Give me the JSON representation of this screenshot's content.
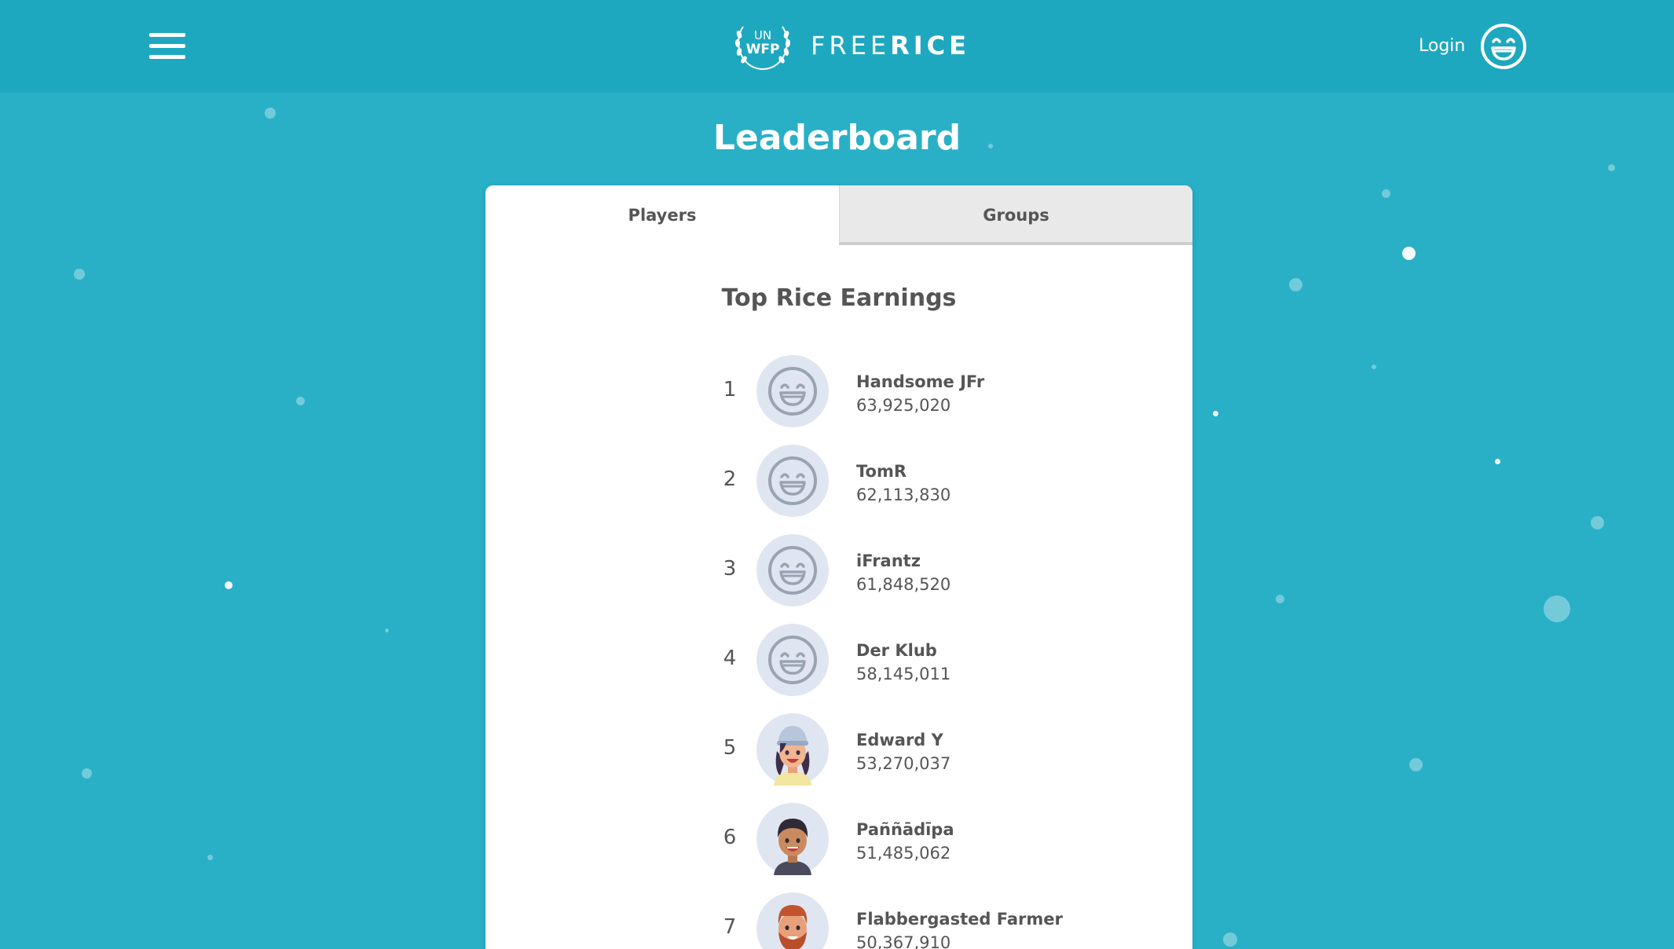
{
  "header": {
    "logo_un": "UN",
    "logo_wfp": "WFP",
    "logo_free": "FREE",
    "logo_rice": "RICE",
    "login_label": "Login",
    "brand_color": "#1ea8c0",
    "background_color": "#29b0c6"
  },
  "page": {
    "title": "Leaderboard"
  },
  "tabs": [
    {
      "label": "Players",
      "active": true
    },
    {
      "label": "Groups",
      "active": false
    }
  ],
  "leaderboard": {
    "title": "Top Rice Earnings",
    "entries": [
      {
        "rank": "1",
        "name": "Handsome JFr",
        "score": "63,925,020",
        "avatar": "default-smiley"
      },
      {
        "rank": "2",
        "name": "TomR",
        "score": "62,113,830",
        "avatar": "default-smiley"
      },
      {
        "rank": "3",
        "name": "iFrantz",
        "score": "61,848,520",
        "avatar": "default-smiley"
      },
      {
        "rank": "4",
        "name": "Der Klub",
        "score": "58,145,011",
        "avatar": "default-smiley"
      },
      {
        "rank": "5",
        "name": "Edward Y",
        "score": "53,270,037",
        "avatar": "girl-with-cap"
      },
      {
        "rank": "6",
        "name": "Paññādīpa",
        "score": "51,485,062",
        "avatar": "boy-dark-hair"
      },
      {
        "rank": "7",
        "name": "Flabbergasted Farmer",
        "score": "50,367,910",
        "avatar": "bearded-farmer"
      }
    ]
  }
}
